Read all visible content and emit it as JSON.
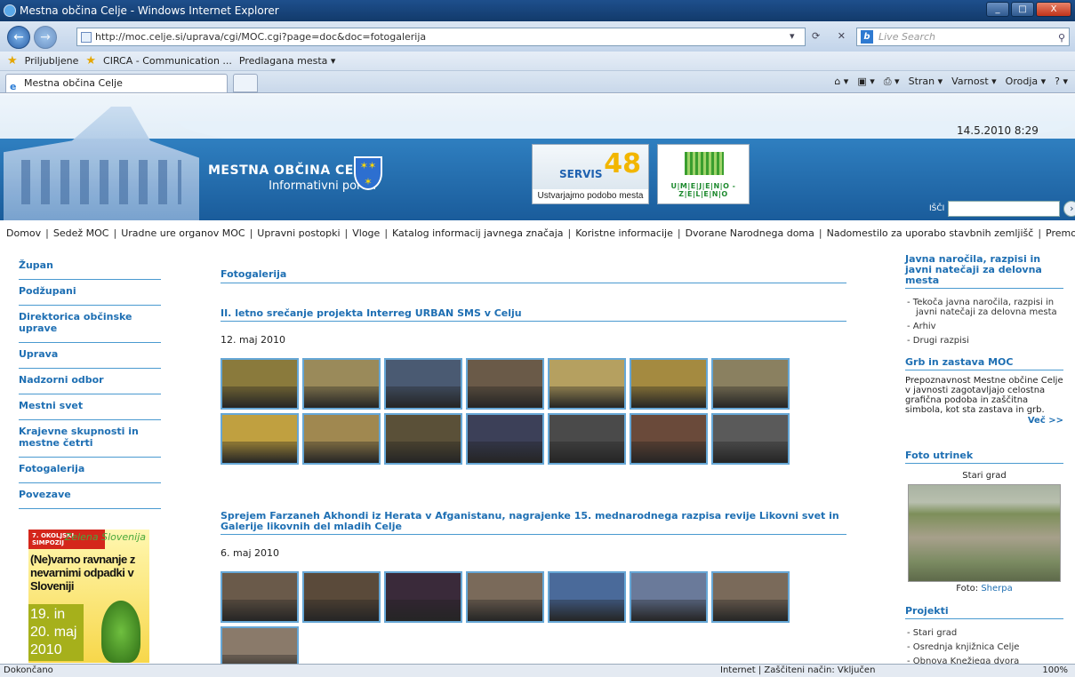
{
  "window": {
    "title": "Mestna občina Celje - Windows Internet Explorer",
    "min": "_",
    "max": "□",
    "close": "X"
  },
  "browser": {
    "url": "http://moc.celje.si/uprava/cgi/MOC.cgi?page=doc&doc=fotogalerija",
    "livesearch_placeholder": "Live Search",
    "favorites": [
      "Priljubljene",
      "CIRCA - Communication ...",
      "Predlagana mesta ▾"
    ],
    "tab_title": "Mestna občina Celje",
    "commands": [
      "Stran ▾",
      "Varnost ▾",
      "Orodja ▾"
    ]
  },
  "status": {
    "left": "Dokončano",
    "zone": "Internet | Zaščiteni način: Vključen",
    "zoom": "100%"
  },
  "header": {
    "title": "MESTNA OBČINA CELJE",
    "subtitle": "Informativni portal",
    "servis_number": "48",
    "servis_label": "SERVIS",
    "servis_caption": "Ustvarjajmo podobo mesta",
    "zeleno": "U|M|E|J|E|N|O - Z|E|L|E|N|O",
    "datetime": "14.5.2010  8:29",
    "search_label": "IŠČI"
  },
  "topnav": [
    "Domov",
    "Sedež MOC",
    "Uradne ure organov MOC",
    "Upravni postopki",
    "Vloge",
    "Katalog informacij javnega značaja",
    "Koristne informacije",
    "Dvorane Narodnega doma",
    "Nadomestilo za uporabo stavbnih zemljišč",
    "Premoženje MOC"
  ],
  "leftnav": [
    "Župan",
    "Podžupani",
    "Direktorica občinske uprave",
    "Uprava",
    "Nadzorni odbor",
    "Mestni svet",
    "Krajevne skupnosti in mestne četrti",
    "Fotogalerija",
    "Povezave"
  ],
  "ad": {
    "head": "7. OKOLJSKI SIMPOZIJ",
    "slogan": "Zelena Slovenija",
    "main": "(Ne)varno ravnanje z nevarnimi odpadki v Sloveniji",
    "dates": "19. in 20. maj 2010"
  },
  "main": {
    "section": "Fotogalerija",
    "events": [
      {
        "title": "II. letno srečanje projekta Interreg URBAN SMS v Celju",
        "date": "12. maj 2010",
        "thumbs": [
          "#8a7a3c",
          "#9a8a5a",
          "#4a5a72",
          "#6a5a48",
          "#b5a060",
          "#a48a40",
          "#8a8060",
          "#c0a040",
          "#a08850",
          "#5a5038",
          "#3c4058",
          "#4a4a4a",
          "#6a4a3a",
          "#5a5a5a"
        ]
      },
      {
        "title": "Sprejem Farzaneh Akhondi iz Herata v Afganistanu, nagrajenke 15. mednarodnega razpisa revije Likovni svet in Galerije likovnih del mladih Celje",
        "date": "6. maj 2010",
        "thumbs": [
          "#6a5a4a",
          "#5a4a3a",
          "#3a2a3a",
          "#7a6a5a",
          "#4a6a9a",
          "#6a7a9a",
          "#7a6a5a",
          "#8a7a6a"
        ]
      }
    ]
  },
  "right": {
    "sec1_title": "Javna naročila, razpisi in javni natečaji za delovna mesta",
    "sec1_items": [
      "- Tekoča javna naročila, razpisi in javni natečaji za delovna mesta",
      "- Arhiv",
      "- Drugi razpisi"
    ],
    "sec2_title": "Grb in zastava MOC",
    "sec2_text": "Prepoznavnost Mestne občine Celje v javnosti zagotavljajo celostna grafična podoba in zaščitna simbola, kot sta zastava in grb.",
    "sec2_more": "Več >>",
    "sec3_title": "Foto utrinek",
    "sec3_caption": "Stari grad",
    "sec3_credit_label": "Foto:",
    "sec3_credit": "Sherpa",
    "sec4_title": "Projekti",
    "sec4_items": [
      "- Stari grad",
      "- Osrednja knjižnica Celje",
      "- Obnova Knežjega dvora"
    ]
  }
}
